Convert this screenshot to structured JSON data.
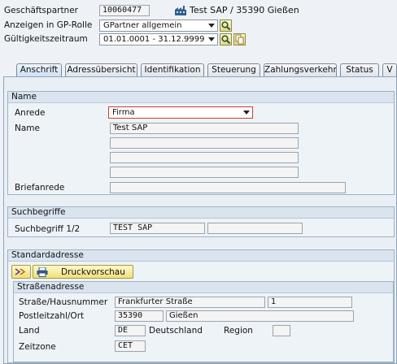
{
  "header": {
    "bp_label": "Geschäftspartner",
    "bp_number": "10060477",
    "bp_description": "Test SAP / 35390 Gießen",
    "role_label": "Anzeigen in GP-Rolle",
    "role_value": "GPartner allgemein",
    "validity_label": "Gültigkeitszeitraum",
    "validity_value": "01.01.0001 - 31.12.9999"
  },
  "tabs": [
    {
      "label": "Anschrift",
      "active": true
    },
    {
      "label": "Adressübersicht"
    },
    {
      "label": "Identifikation"
    },
    {
      "label": "Steuerung"
    },
    {
      "label": "Zahlungsverkehr"
    },
    {
      "label": "Status"
    },
    {
      "label": "V"
    }
  ],
  "name_group": {
    "title": "Name",
    "anrede_label": "Anrede",
    "anrede_value": "Firma",
    "name_label": "Name",
    "name_value": "Test SAP",
    "briefanrede_label": "Briefanrede"
  },
  "search_group": {
    "title": "Suchbegriffe",
    "label": "Suchbegriff 1/2",
    "value1": "TEST SAP",
    "value2": ""
  },
  "address_group": {
    "title": "Standardadresse",
    "print_preview_label": "Druckvorschau",
    "street_title": "Straßenadresse",
    "street_label": "Straße/Hausnummer",
    "street_value": "Frankfurter Straße",
    "house_number": "1",
    "postcode_label": "Postleitzahl/Ort",
    "postcode_value": "35390",
    "city_value": "Gießen",
    "country_label": "Land",
    "country_code": "DE",
    "country_name": "Deutschland",
    "region_label": "Region",
    "region_value": "",
    "timezone_label": "Zeitzone",
    "timezone_value": "CET"
  },
  "icons": [
    "factory-icon",
    "search-icon",
    "search-icon",
    "copy-icon",
    "expand-icon",
    "printer-icon"
  ]
}
